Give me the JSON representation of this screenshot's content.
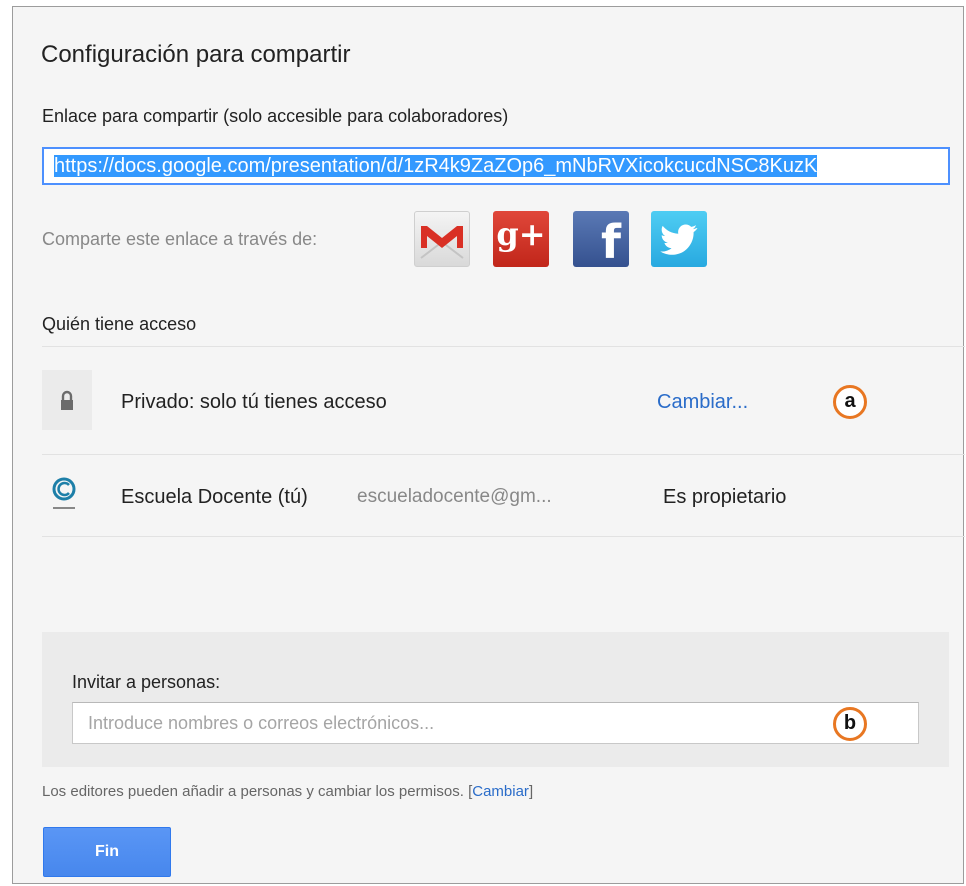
{
  "dialog": {
    "title": "Configuración para compartir",
    "link_label": "Enlace para compartir (solo accesible para colaboradores)",
    "link_value": "https://docs.google.com/presentation/d/1zR4k9ZaZOp6_mNbRVXicokcucdNSC8KuzK",
    "share_via_label": "Comparte este enlace a través de:",
    "share_icons": [
      {
        "name": "gmail-icon",
        "glyph": "M"
      },
      {
        "name": "google-plus-icon",
        "glyph": "g+"
      },
      {
        "name": "facebook-icon",
        "glyph": "f"
      },
      {
        "name": "twitter-icon",
        "glyph": "bird"
      }
    ]
  },
  "access": {
    "heading": "Quién tiene acceso",
    "private_row": {
      "icon": "lock-icon",
      "text": "Privado: solo tú tienes acceso",
      "change_link": "Cambiar..."
    },
    "owner_row": {
      "icon": "escuela-docente-logo",
      "name": "Escuela Docente (tú)",
      "email": "escueladocente@gm...",
      "role": "Es propietario"
    }
  },
  "invite": {
    "label": "Invitar a personas:",
    "placeholder": "Introduce nombres o correos electrónicos...",
    "value": ""
  },
  "footer": {
    "note": "Los editores pueden añadir a personas y cambiar los permisos.",
    "bracket_open": "[",
    "change_link": "Cambiar",
    "bracket_close": "]",
    "done_button": "Fin"
  },
  "markers": {
    "a": "a",
    "b": "b"
  },
  "colors": {
    "accent_blue": "#4d90fe",
    "link_blue": "#2a6cc9",
    "marker_orange": "#e87722",
    "gmail_red": "#d93025",
    "gplus_red": "#dd4b39",
    "facebook_blue": "#3b5998",
    "twitter_blue": "#33b5ea"
  }
}
